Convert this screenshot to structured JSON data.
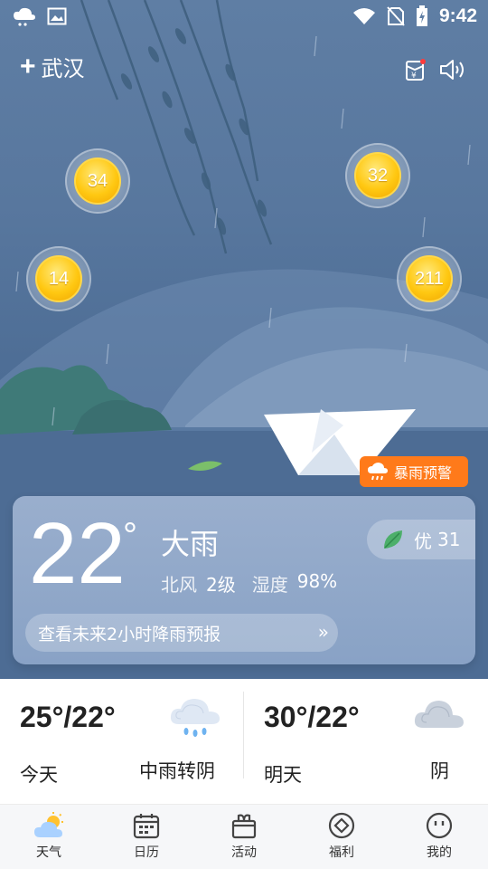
{
  "status_bar": {
    "time": "9:42"
  },
  "header": {
    "add_icon": "+",
    "city": "武汉"
  },
  "coins": [
    "34",
    "32",
    "14",
    "211"
  ],
  "alert": {
    "label": "暴雨预警"
  },
  "current": {
    "temperature": "22",
    "degree": "°",
    "condition": "大雨",
    "wind_dir": "北风",
    "wind_level": "2级",
    "humidity_label": "湿度",
    "humidity_value": "98%",
    "aqi_label": "优",
    "aqi_value": "31",
    "rain_forecast": "查看未来2小时降雨预报",
    "chevron": "»"
  },
  "daily": [
    {
      "range": "25°/22°",
      "label": "今天",
      "desc": "中雨转阴"
    },
    {
      "range": "30°/22°",
      "label": "明天",
      "desc": "阴"
    }
  ],
  "nav": [
    {
      "label": "天气",
      "icon": "weather-icon"
    },
    {
      "label": "日历",
      "icon": "calendar-icon"
    },
    {
      "label": "活动",
      "icon": "gift-icon"
    },
    {
      "label": "福利",
      "icon": "diamond-icon"
    },
    {
      "label": "我的",
      "icon": "smiley-icon"
    }
  ],
  "colors": {
    "alert": "#ff7a1a",
    "coin": "#ffc812",
    "sky": "#5f7ea4"
  }
}
